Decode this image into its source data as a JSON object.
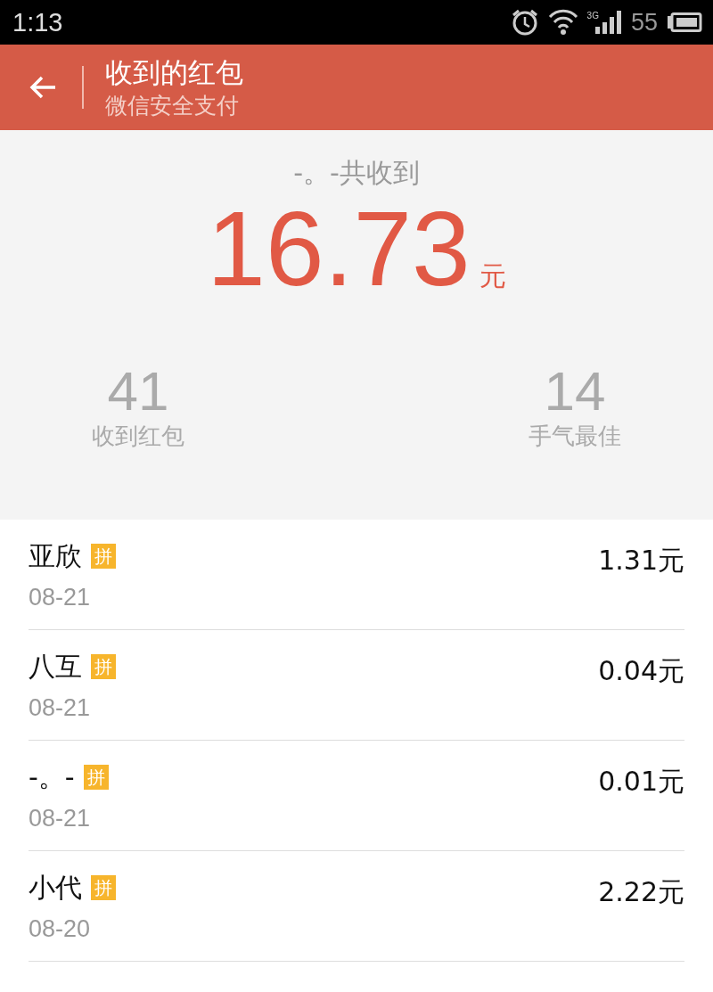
{
  "status_bar": {
    "time": "1:13",
    "signal_label": "3G",
    "battery": "55"
  },
  "header": {
    "title": "收到的红包",
    "subtitle": "微信安全支付"
  },
  "summary": {
    "caption": "-。-共收到",
    "amount": "16.73",
    "unit": "元",
    "stats": [
      {
        "value": "41",
        "label": "收到红包"
      },
      {
        "value": "14",
        "label": "手气最佳"
      }
    ]
  },
  "records": [
    {
      "name": "亚欣",
      "tag": "拼",
      "date": "08-21",
      "amount": "1.31元"
    },
    {
      "name": "八互",
      "tag": "拼",
      "date": "08-21",
      "amount": "0.04元"
    },
    {
      "name": "-。-",
      "tag": "拼",
      "date": "08-21",
      "amount": "0.01元"
    },
    {
      "name": "小代",
      "tag": "拼",
      "date": "08-20",
      "amount": "2.22元"
    }
  ]
}
